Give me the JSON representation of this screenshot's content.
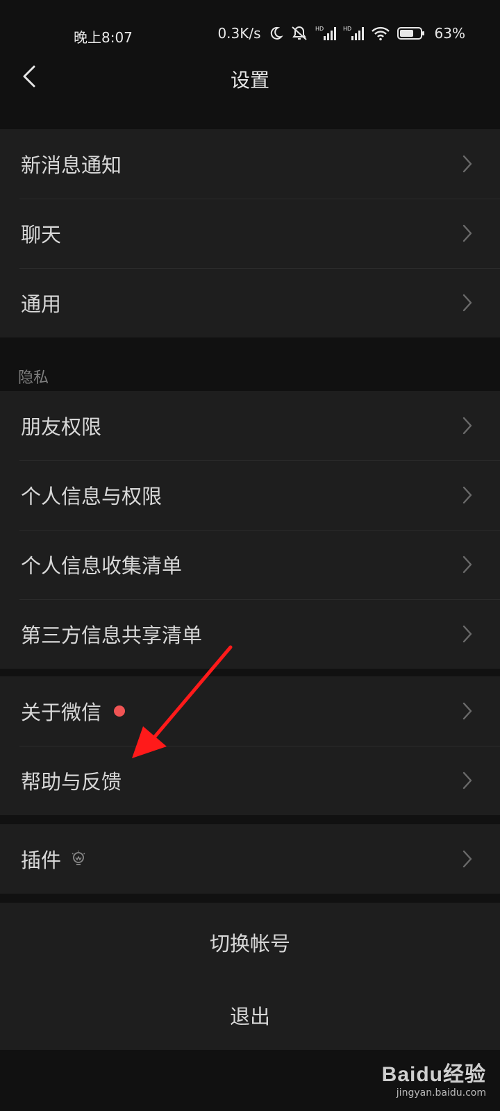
{
  "status_bar": {
    "time": "晚上8:07",
    "net_speed": "0.3K/s",
    "battery_pct": "63%",
    "icons": [
      "moon-icon",
      "mute-icon",
      "signal-hd-icon",
      "signal-hd-icon",
      "wifi-icon",
      "battery-icon"
    ]
  },
  "nav": {
    "title": "设置",
    "back_icon": "chevron-left-icon"
  },
  "group1": {
    "items": [
      {
        "label": "新消息通知"
      },
      {
        "label": "聊天"
      },
      {
        "label": "通用"
      }
    ]
  },
  "privacy": {
    "title": "隐私",
    "items": [
      {
        "label": "朋友权限"
      },
      {
        "label": "个人信息与权限"
      },
      {
        "label": "个人信息收集清单"
      },
      {
        "label": "第三方信息共享清单"
      }
    ]
  },
  "group3": {
    "items": [
      {
        "label": "关于微信",
        "badge": "red-dot"
      },
      {
        "label": "帮助与反馈"
      }
    ]
  },
  "plugins": {
    "label": "插件",
    "icon": "lightbulb-icon"
  },
  "switch_account": {
    "label": "切换帐号"
  },
  "logout": {
    "label": "退出"
  },
  "annotation": {
    "arrow_color": "#ff1a1a"
  },
  "watermark": {
    "logo": "Baidu经验",
    "site": "jingyan.baidu.com"
  }
}
